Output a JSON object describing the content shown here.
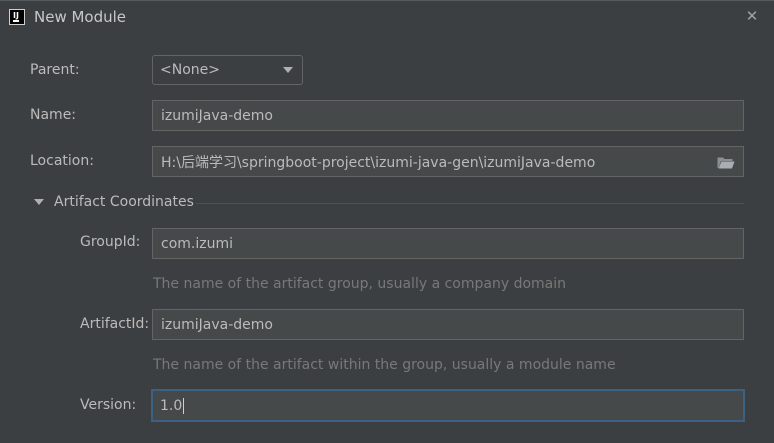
{
  "window": {
    "title": "New Module",
    "close_icon": "close-icon"
  },
  "form": {
    "parent": {
      "label": "Parent:",
      "value": "<None>"
    },
    "name": {
      "label": "Name:",
      "value": "izumiJava-demo"
    },
    "location": {
      "label": "Location:",
      "value": "H:\\后端学习\\springboot-project\\izumi-java-gen\\izumiJava-demo"
    },
    "artifact_section": {
      "title": "Artifact Coordinates"
    },
    "group_id": {
      "label": "GroupId:",
      "value": "com.izumi",
      "hint": "The name of the artifact group, usually a company domain"
    },
    "artifact_id": {
      "label": "ArtifactId:",
      "value": "izumiJava-demo",
      "hint": "The name of the artifact within the group, usually a module name"
    },
    "version": {
      "label": "Version:",
      "value": "1.0"
    }
  },
  "colors": {
    "background": "#3c3f41",
    "field_bg": "#45494a",
    "focus_border": "#3d6185",
    "hint": "#787878"
  }
}
